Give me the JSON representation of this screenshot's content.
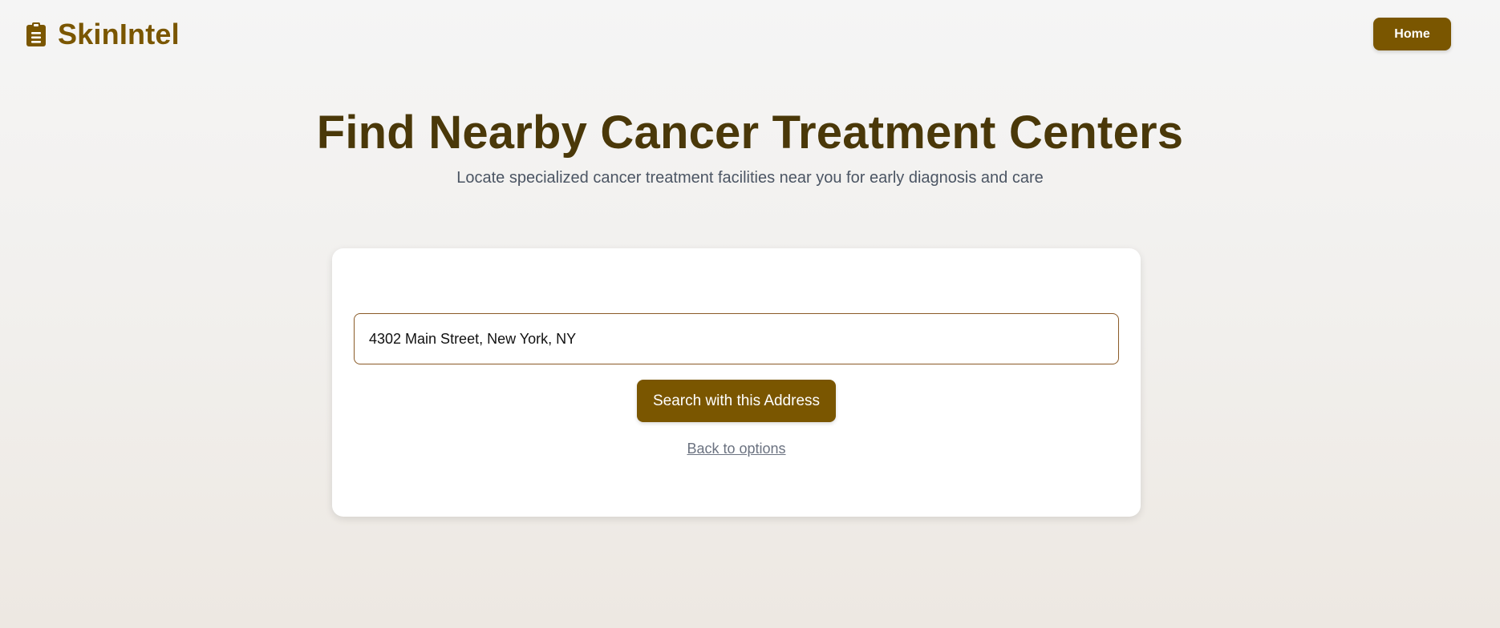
{
  "header": {
    "brand_icon": "clipboard-icon",
    "brand_name": "SkinIntel",
    "home_label": "Home"
  },
  "hero": {
    "title": "Find Nearby Cancer Treatment Centers",
    "subtitle": "Locate specialized cancer treatment facilities near you for early diagnosis and care"
  },
  "search": {
    "address_value": "4302 Main Street, New York, NY",
    "submit_label": "Search with this Address",
    "back_label": "Back to options"
  },
  "colors": {
    "brand": "#7a5600",
    "title": "#4a3809",
    "subtitle": "#4b5563",
    "link": "#6b7280",
    "input_border": "#8a5a27",
    "card": "#ffffff"
  }
}
